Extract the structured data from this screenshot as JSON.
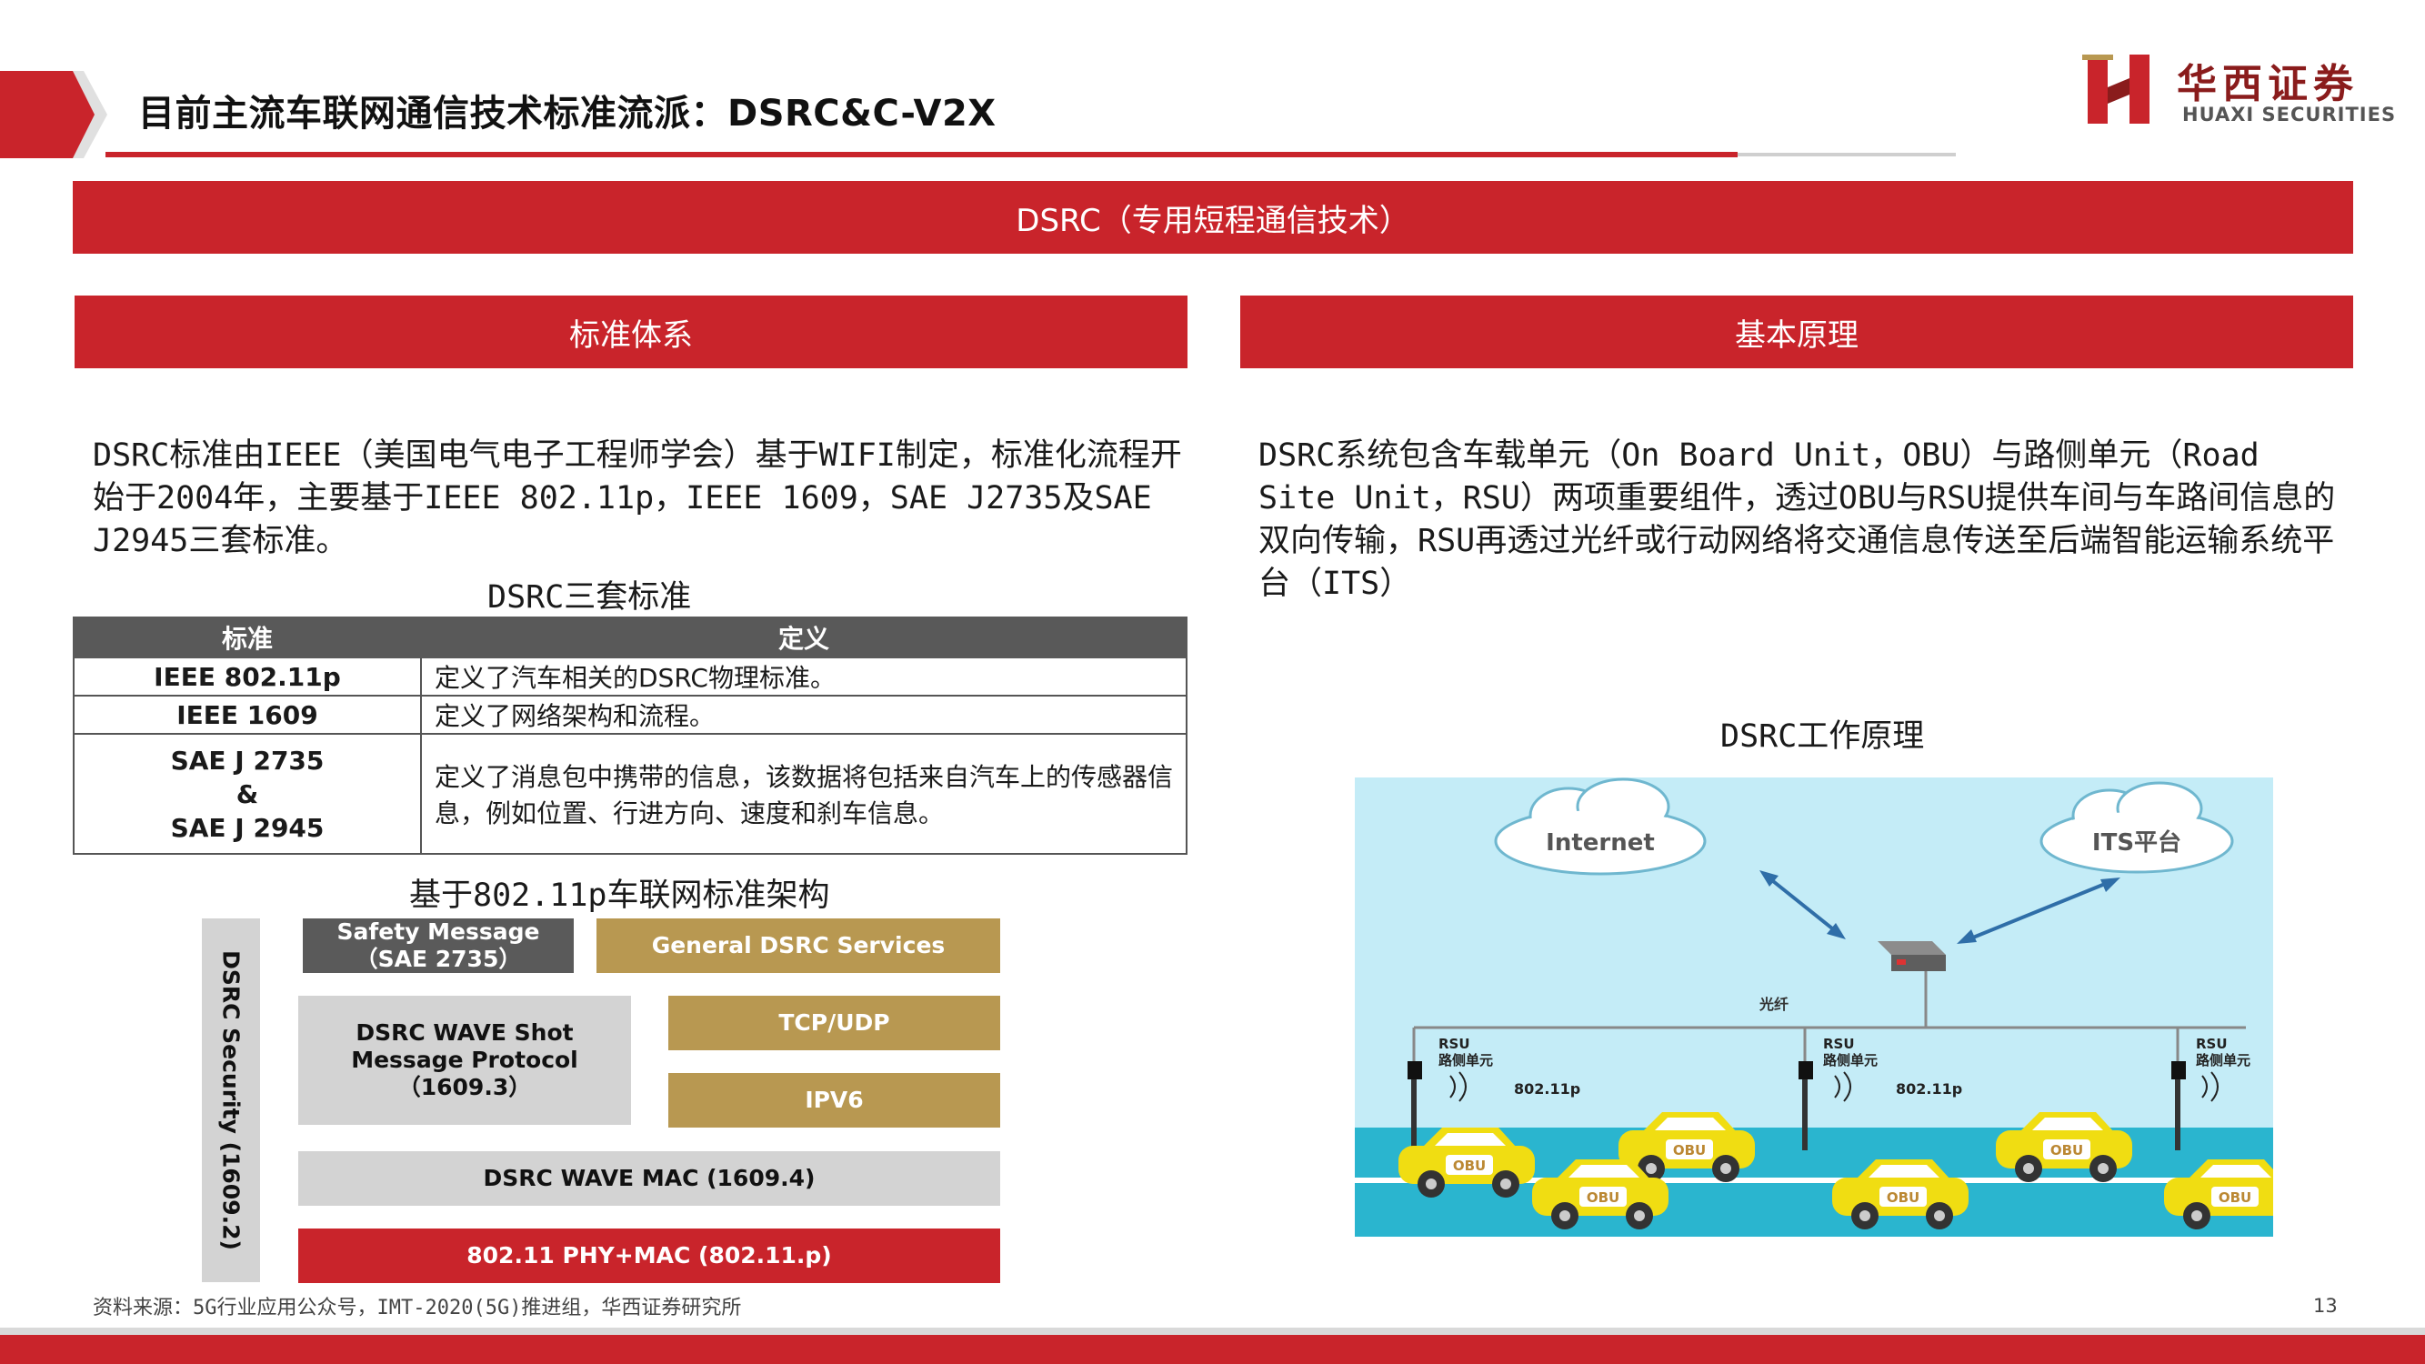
{
  "header": {
    "title": "目前主流车联网通信技术标准流派：DSRC&C-V2X",
    "logo_cn": "华西证券",
    "logo_en": "HUAXI SECURITIES"
  },
  "main_banner": "DSRC（专用短程通信技术）",
  "left": {
    "banner": "标准体系",
    "paragraph": "DSRC标准由IEEE（美国电气电子工程师学会）基于WIFI制定，标准化流程开始于2004年，主要基于IEEE 802.11p，IEEE 1609，SAE J2735及SAE J2945三套标准。",
    "table_caption": "DSRC三套标准",
    "table": {
      "headers": [
        "标准",
        "定义"
      ],
      "rows": [
        {
          "standard": "IEEE 802.11p",
          "definition": "定义了汽车相关的DSRC物理标准。"
        },
        {
          "standard": "IEEE 1609",
          "definition": "定义了网络架构和流程。"
        },
        {
          "standard_lines": [
            "SAE J 2735",
            "&",
            "SAE J 2945"
          ],
          "definition": "定义了消息包中携带的信息，该数据将包括来自汽车上的传感器信息，例如位置、行进方向、速度和刹车信息。"
        }
      ]
    },
    "arch_caption": "基于802.11p车联网标准架构",
    "arch": {
      "security": "DSRC Security (1609.2)",
      "safety_line1": "Safety Message",
      "safety_line2": "（SAE 2735）",
      "general": "General DSRC Services",
      "wave_line1": "DSRC WAVE Shot",
      "wave_line2": "Message Protocol（1609.3）",
      "tcp": "TCP/UDP",
      "ipv6": "IPV6",
      "mac": "DSRC WAVE MAC (1609.4)",
      "phy": "802.11 PHY+MAC (802.11.p)"
    }
  },
  "right": {
    "banner": "基本原理",
    "paragraph": "DSRC系统包含车载单元（On Board Unit，OBU）与路侧单元（Road Site Unit，RSU）两项重要组件，透过OBU与RSU提供车间与车路间信息的双向传输，RSU再透过光纤或行动网络将交通信息传送至后端智能运输系统平台（ITS）",
    "picture_caption": "DSRC工作原理",
    "picture": {
      "cloud1": "Internet",
      "cloud2": "ITS平台",
      "fiber": "光纤",
      "rsu": "RSU",
      "rsu_cn": "路侧单元",
      "wifi": "802.11p",
      "obu": "OBU"
    }
  },
  "footer": {
    "source": "资料来源：5G行业应用公众号，IMT-2020(5G)推进组，华西证券研究所",
    "page": "13"
  },
  "colors": {
    "brand_red": "#c9242b",
    "gold": "#b89851",
    "dark_gray": "#5a5a5a",
    "light_gray": "#d3d3d3",
    "sky": "#c4ecf7",
    "taxi_yellow": "#f0dd12"
  }
}
